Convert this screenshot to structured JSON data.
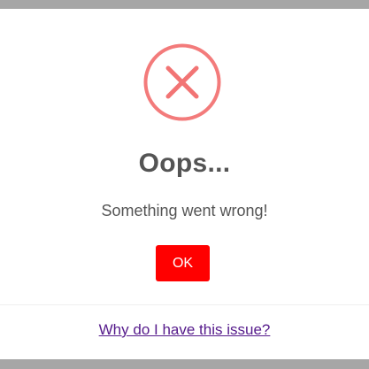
{
  "dialog": {
    "icon": "error-x-icon",
    "icon_color": "#f27474",
    "title": "Oops...",
    "message": "Something went wrong!",
    "confirm_label": "OK",
    "confirm_color": "#ff0000",
    "footer_link_text": "Why do I have this issue?",
    "footer_link_color": "#551a8b"
  }
}
